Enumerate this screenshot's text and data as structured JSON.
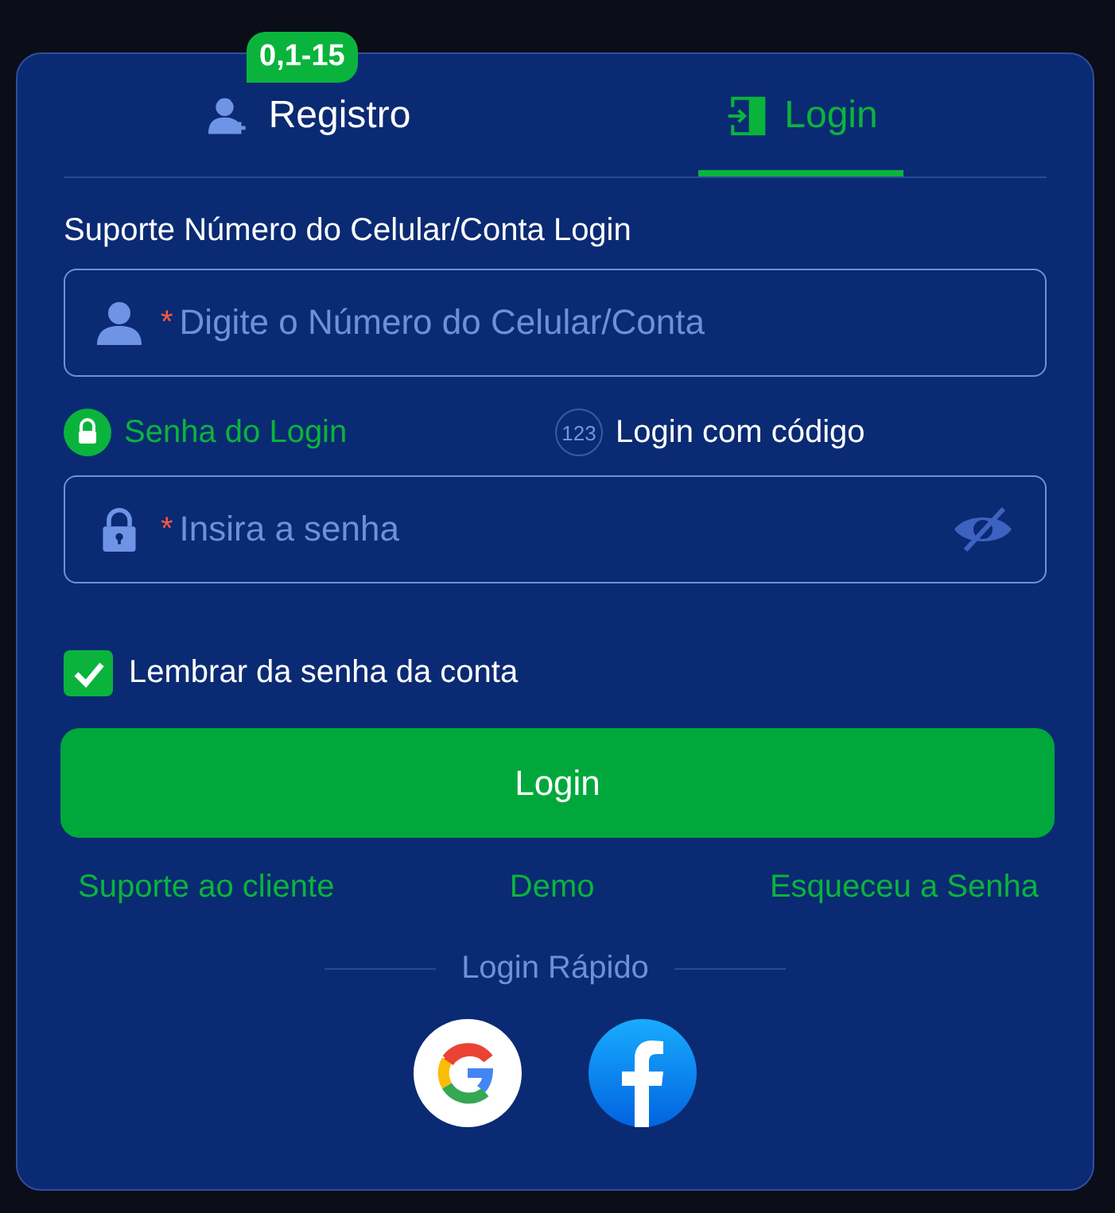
{
  "tabs": [
    {
      "label": "Registro",
      "selected": false,
      "kind": "register",
      "badge": "0,1-15"
    },
    {
      "label": "Login",
      "selected": true,
      "kind": "login"
    }
  ],
  "account_label": "Suporte Número do Celular/Conta Login",
  "account_field": {
    "required_mark": "*",
    "placeholder": "Digite o Número do Celular/Conta"
  },
  "login_modes": [
    {
      "label": "Senha do Login",
      "selected": true,
      "kind": "password"
    },
    {
      "label": "Login com código",
      "selected": false,
      "kind": "code",
      "icon_text": "123"
    }
  ],
  "password_field": {
    "required_mark": "*",
    "placeholder": "Insira a senha"
  },
  "remember": {
    "label": "Lembrar da senha da conta",
    "checked": true
  },
  "login_button": "Login",
  "links": [
    "Suporte ao cliente",
    "Demo",
    "Esqueceu a Senha"
  ],
  "quick_login": {
    "title": "Login Rápido",
    "providers": [
      {
        "kind": "google"
      },
      {
        "kind": "facebook"
      }
    ]
  }
}
